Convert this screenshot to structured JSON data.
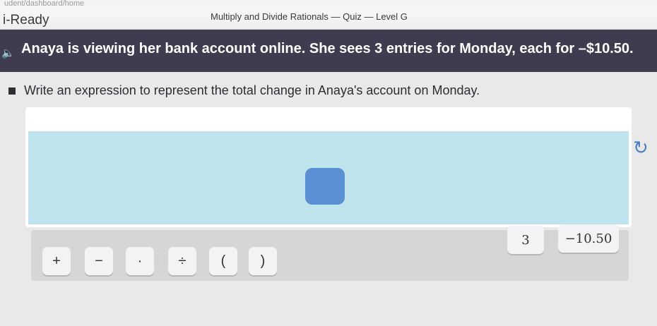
{
  "browser": {
    "url_fragment": "udent/dashboard/home"
  },
  "header": {
    "brand": "i-Ready",
    "quiz_title": "Multiply and Divide Rationals — Quiz — Level G"
  },
  "banner": {
    "prompt": "Anaya is viewing her bank account online. She sees 3 entries for Monday, each for –$10.50."
  },
  "question": {
    "text": "Write an expression to represent the total change in Anaya's account on Monday."
  },
  "keypad": {
    "plus": "+",
    "minus": "−",
    "dot": "·",
    "divide": "÷",
    "lparen": "(",
    "rparen": ")"
  },
  "tiles": {
    "three": "3",
    "neg_amount": "−10.50"
  },
  "icons": {
    "speaker": "speaker-icon",
    "reset": "reset-icon"
  }
}
